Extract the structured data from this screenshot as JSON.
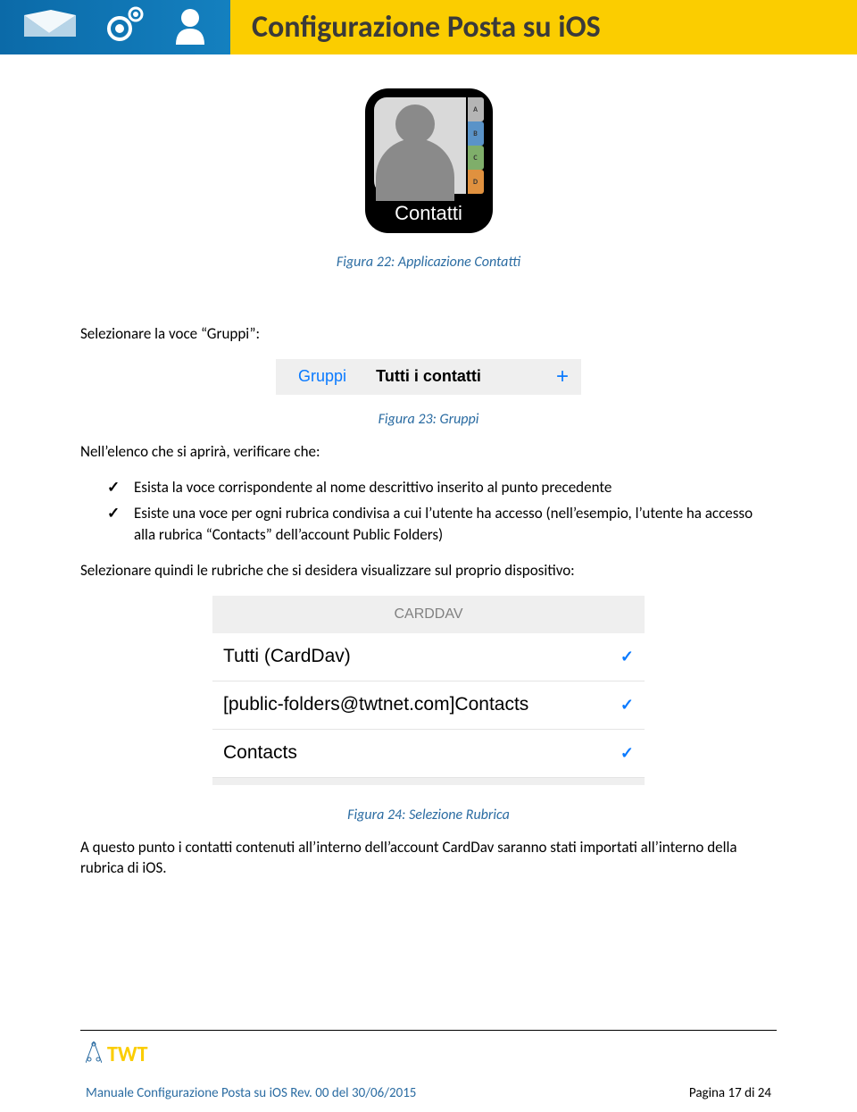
{
  "header": {
    "title": "Configurazione Posta su iOS"
  },
  "contacts_app": {
    "label": "Contatti",
    "tabs": [
      "A",
      "B",
      "C",
      "D"
    ]
  },
  "fig22_caption": "Figura 22: Applicazione Contatti",
  "p1": "Selezionare la voce “Gruppi”:",
  "ios_bar": {
    "left": "Gruppi",
    "center": "Tutti i contatti",
    "right": "+"
  },
  "fig23_caption": "Figura 23: Gruppi",
  "p2": "Nell’elenco che si aprirà, verificare che:",
  "bullets": [
    "Esista la voce corrispondente al nome descrittivo inserito al punto precedente",
    "Esiste una voce per ogni rubrica condivisa a cui l’utente ha accesso (nell’esempio, l’utente ha accesso alla rubrica “Contacts” dell’account Public Folders)"
  ],
  "p3": "Selezionare quindi le rubriche che si desidera visualizzare sul proprio dispositivo:",
  "carddav": {
    "header": "CARDDAV",
    "rows": [
      "Tutti (CardDav)",
      "[public-folders@twtnet.com]Contacts",
      "Contacts"
    ]
  },
  "fig24_caption": "Figura 24: Selezione Rubrica",
  "p4": "A questo punto i contatti contenuti all’interno dell’account CardDav saranno stati importati all’interno della rubrica di iOS.",
  "footer": {
    "brand": "TWT",
    "doc_line": "Manuale Configurazione Posta su iOS Rev. 00 del 30/06/2015",
    "page_label": "Pagina 17 di 24"
  }
}
